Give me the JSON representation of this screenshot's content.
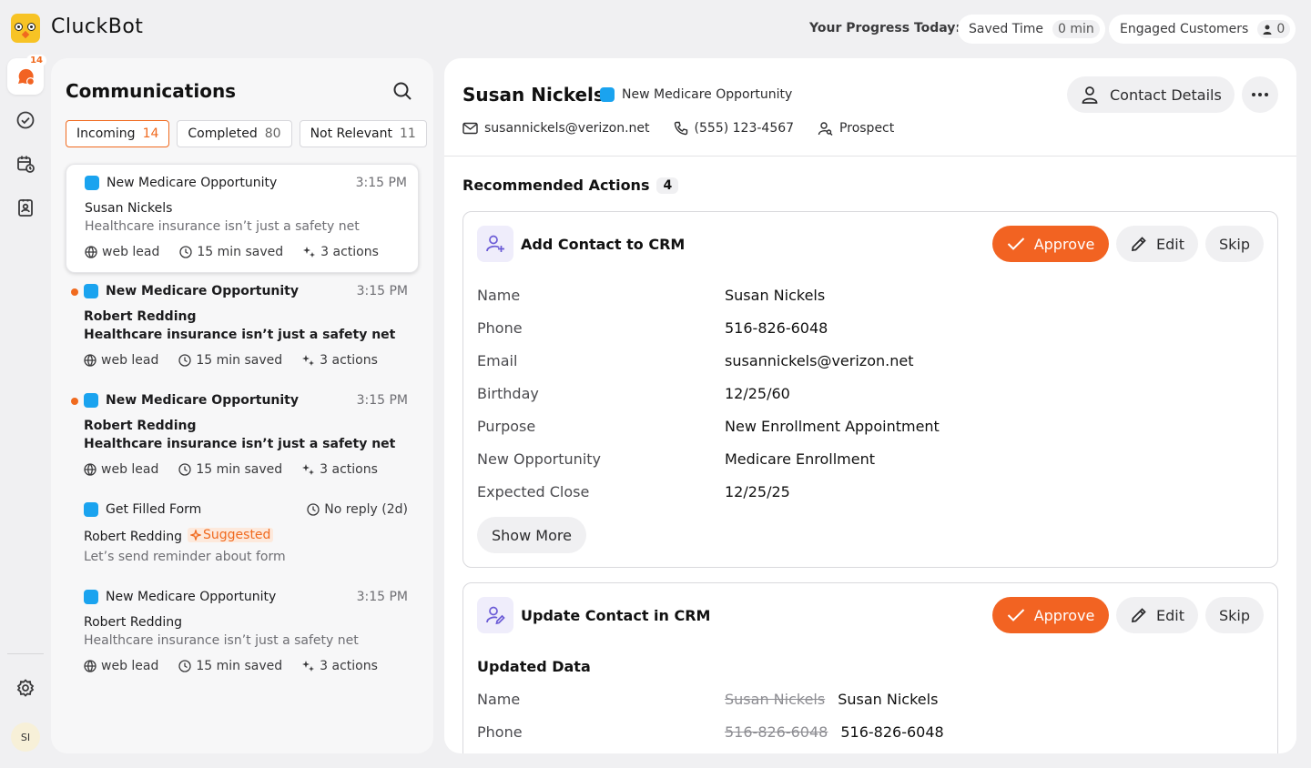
{
  "app": {
    "brand": "CluckBot",
    "progress_label": "Your Progress Today:",
    "saved_time_label": "Saved Time",
    "saved_time_value": "0 min",
    "engaged_label": "Engaged Customers",
    "engaged_value": "0"
  },
  "rail": {
    "inbox_badge": "14",
    "avatar_initials": "SI"
  },
  "communications": {
    "title": "Communications",
    "tabs": [
      {
        "label": "Incoming",
        "count": "14"
      },
      {
        "label": "Completed",
        "count": "80"
      },
      {
        "label": "Not Relevant",
        "count": "11"
      }
    ],
    "items": [
      {
        "type": "New Medicare Opportunity",
        "time": "3:15 PM",
        "name": "Susan Nickels",
        "message": "Healthcare insurance isn’t just a safety net",
        "source": "web lead",
        "saved": "15 min saved",
        "actions": "3 actions"
      },
      {
        "type": "New Medicare Opportunity",
        "time": "3:15 PM",
        "name": "Robert Redding",
        "message": "Healthcare insurance isn’t just a safety net",
        "source": "web lead",
        "saved": "15 min saved",
        "actions": "3 actions"
      },
      {
        "type": "New Medicare Opportunity",
        "time": "3:15 PM",
        "name": "Robert Redding",
        "message": "Healthcare insurance isn’t just a safety net",
        "source": "web lead",
        "saved": "15 min saved",
        "actions": "3 actions"
      },
      {
        "type": "Get Filled Form",
        "status": "No reply (2d)",
        "name": "Robert Redding",
        "suggested": "Suggested",
        "message": "Let’s send reminder about form"
      },
      {
        "type": "New Medicare Opportunity",
        "time": "3:15 PM",
        "name": "Robert Redding",
        "message": "Healthcare insurance isn’t just a safety net",
        "source": "web lead",
        "saved": "15 min saved",
        "actions": "3 actions"
      }
    ]
  },
  "contact": {
    "name": "Susan Nickels",
    "tag": "New Medicare Opportunity",
    "email": "susannickels@verizon.net",
    "phone": "(555) 123-4567",
    "status": "Prospect",
    "details_button": "Contact Details"
  },
  "recommended": {
    "title": "Recommended Actions",
    "count": "4",
    "approve_label": "Approve",
    "edit_label": "Edit",
    "skip_label": "Skip",
    "add_card": {
      "title": "Add Contact to CRM",
      "fields": [
        {
          "label": "Name",
          "value": "Susan Nickels"
        },
        {
          "label": "Phone",
          "value": "516-826-6048"
        },
        {
          "label": "Email",
          "value": "susannickels@verizon.net"
        },
        {
          "label": "Birthday",
          "value": "12/25/60"
        },
        {
          "label": "Purpose",
          "value": "New Enrollment Appointment"
        },
        {
          "label": "New Opportunity",
          "value": "Medicare Enrollment"
        },
        {
          "label": "Expected Close",
          "value": "12/25/25"
        }
      ],
      "show_more": "Show More"
    },
    "update_card": {
      "title": "Update Contact in CRM",
      "subtitle": "Updated Data",
      "fields": [
        {
          "label": "Name",
          "old": "Susan Nickels",
          "value": "Susan Nickels"
        },
        {
          "label": "Phone",
          "old": "516-826-6048",
          "value": "516-826-6048"
        }
      ]
    }
  },
  "colors": {
    "accent": "#f26322",
    "tag_blue": "#1aa3ef"
  }
}
